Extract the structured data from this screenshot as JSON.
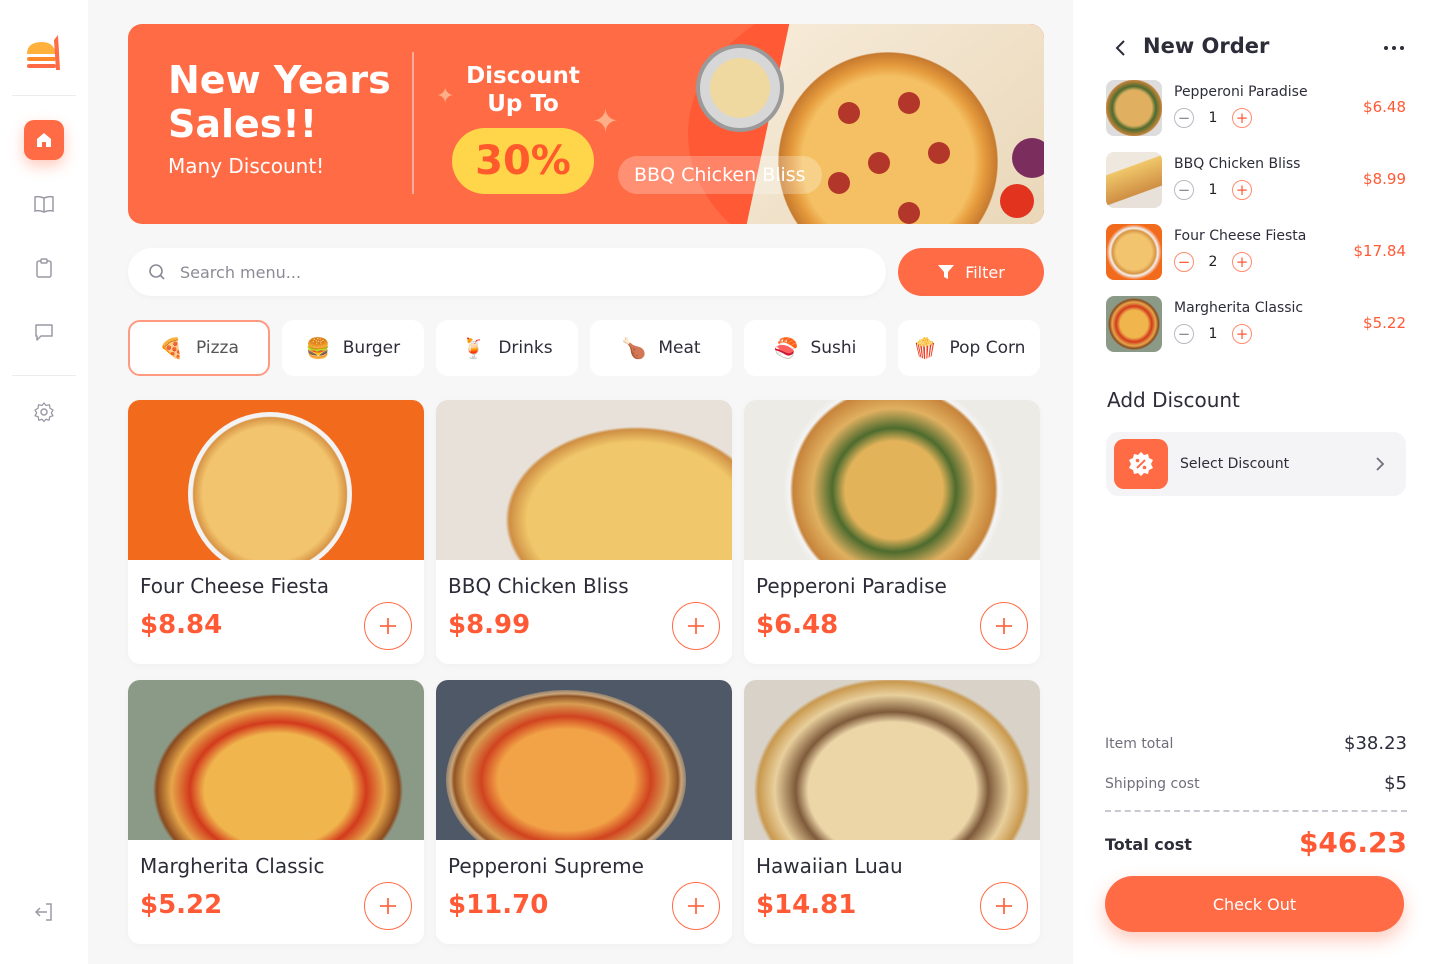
{
  "colors": {
    "accent": "#ff6b45",
    "price": "#ff5a35",
    "badge": "#ffd54a"
  },
  "sidebar": {
    "items": [
      {
        "icon": "home-icon",
        "active": true
      },
      {
        "icon": "book-icon"
      },
      {
        "icon": "clipboard-icon"
      },
      {
        "icon": "chat-icon"
      },
      {
        "icon": "gear-icon"
      },
      {
        "icon": "logout-icon"
      }
    ]
  },
  "banner": {
    "title": "New Years Sales!!",
    "subtitle": "Many Discount!",
    "discount_label": "Discount Up To",
    "discount_value": "30%",
    "tag": "BBQ Chicken Bliss"
  },
  "search": {
    "placeholder": "Search menu..."
  },
  "filter": {
    "label": "Filter"
  },
  "categories": [
    {
      "label": "Pizza",
      "emoji": "🍕",
      "active": true
    },
    {
      "label": "Burger",
      "emoji": "🍔"
    },
    {
      "label": "Drinks",
      "emoji": "🍹"
    },
    {
      "label": "Meat",
      "emoji": "🍗"
    },
    {
      "label": "Sushi",
      "emoji": "🍣"
    },
    {
      "label": "Pop Corn",
      "emoji": "🍿"
    }
  ],
  "menu": [
    {
      "name": "Four Cheese Fiesta",
      "price": "$8.84"
    },
    {
      "name": "BBQ Chicken Bliss",
      "price": "$8.99"
    },
    {
      "name": "Pepperoni Paradise",
      "price": "$6.48"
    },
    {
      "name": "Margherita Classic",
      "price": "$5.22"
    },
    {
      "name": "Pepperoni Supreme",
      "price": "$11.70"
    },
    {
      "name": "Hawaiian Luau",
      "price": "$14.81"
    }
  ],
  "order": {
    "title": "New Order",
    "items": [
      {
        "name": "Pepperoni Paradise",
        "qty": "1",
        "price": "$6.48"
      },
      {
        "name": "BBQ Chicken Bliss",
        "qty": "1",
        "price": "$8.99"
      },
      {
        "name": "Four Cheese Fiesta",
        "qty": "2",
        "price": "$17.84"
      },
      {
        "name": "Margherita Classic",
        "qty": "1",
        "price": "$5.22"
      }
    ],
    "add_discount": "Add Discount",
    "select_discount": "Select Discount",
    "item_total_label": "Item total",
    "item_total": "$38.23",
    "shipping_label": "Shipping cost",
    "shipping": "$5",
    "total_label": "Total cost",
    "total": "$46.23",
    "checkout": "Check Out"
  }
}
